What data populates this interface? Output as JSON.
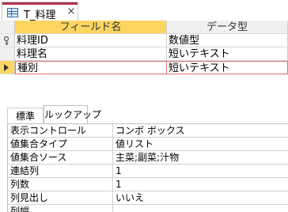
{
  "tab": {
    "title": "T_料理",
    "close_glyph": "×"
  },
  "grid": {
    "headers": {
      "field_name": "フィールド名",
      "data_type": "データ型"
    },
    "rows": [
      {
        "field_name": "料理ID",
        "data_type": "数値型"
      },
      {
        "field_name": "料理名",
        "data_type": "短いテキスト"
      },
      {
        "field_name": "種別",
        "data_type": "短いテキスト"
      }
    ]
  },
  "properties": {
    "tabs": {
      "standard": "標準",
      "lookup": "ルックアップ"
    },
    "rows": [
      {
        "label": "表示コントロール",
        "value": "コンボ ボックス"
      },
      {
        "label": "値集合タイプ",
        "value": "値リスト"
      },
      {
        "label": "値集合ソース",
        "value": "主菜;副菜;汁物"
      },
      {
        "label": "連結列",
        "value": "1"
      },
      {
        "label": "列数",
        "value": "1"
      },
      {
        "label": "列見出し",
        "value": "いいえ"
      },
      {
        "label": "列幅",
        "value": ""
      }
    ]
  },
  "icons": {
    "tab": "table-icon",
    "primary_key": "key-icon",
    "current_row": "current-row-arrow-icon"
  },
  "colors": {
    "selected_header": "#fbd560",
    "tab_accent": "#b1354d",
    "active_row_border": "#e07070"
  }
}
